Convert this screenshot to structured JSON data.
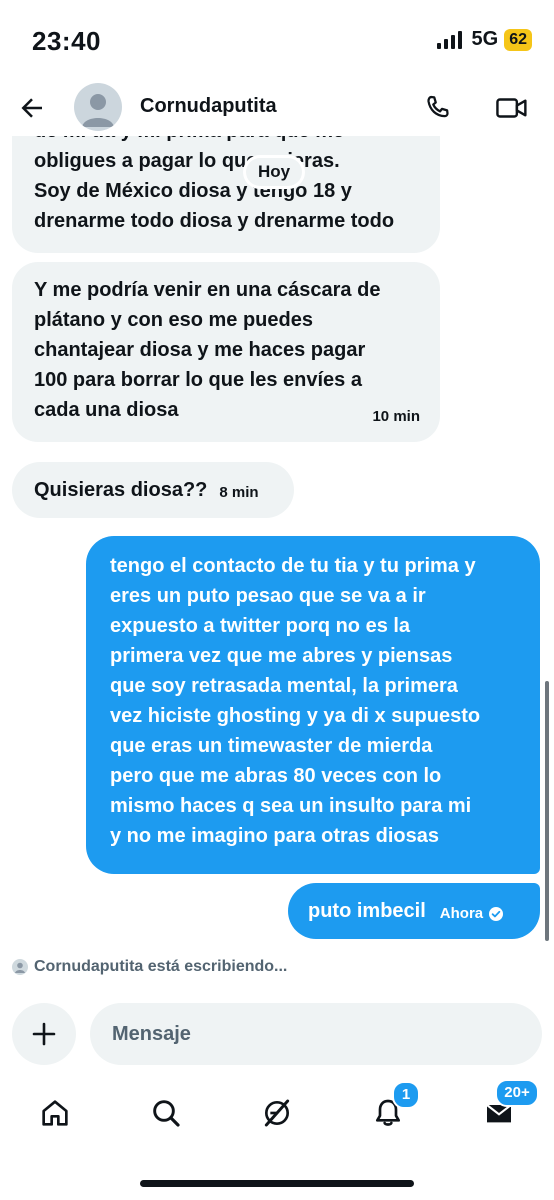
{
  "status_bar": {
    "time": "23:40",
    "network": "5G",
    "battery": "62"
  },
  "header": {
    "contact_name": "Cornudaputita"
  },
  "date_pill": "Hoy",
  "messages": [
    {
      "direction": "in",
      "text": "de mi tia y mi prima para que me\nobligues a pagar lo que quieras.\nSoy de México diosa y tengo 18 y\ndrenarme todo diosa y drenarme todo",
      "time": ""
    },
    {
      "direction": "in",
      "text": "Y me podría venir en una cáscara de\nplátano y con eso me puedes\nchantajear diosa y me haces pagar\n100 para borrar lo que les envíes a\ncada una diosa",
      "time": "10 min"
    },
    {
      "direction": "in",
      "text": "Quisieras diosa??",
      "time": "8 min"
    },
    {
      "direction": "out",
      "text": "tengo el contacto de tu tia y tu prima y\neres un puto pesao que se va a ir\nexpuesto a twitter porq no es la\nprimera vez que me abres y piensas\nque soy retrasada mental, la primera\nvez hiciste ghosting y ya di x supuesto\nque eras un timewaster de mierda\npero que me abras 80 veces con lo\nmismo haces q sea un insulto para mi\ny no me imagino para otras diosas",
      "time": ""
    },
    {
      "direction": "out",
      "text": "puto imbecil",
      "time": "Ahora"
    }
  ],
  "typing_indicator": "Cornudaputita está escribiendo...",
  "composer": {
    "placeholder": "Mensaje"
  },
  "bottom_nav": {
    "notifications_badge": "1",
    "messages_badge": "20+"
  },
  "colors": {
    "accent": "#1d9bf0",
    "bubble_in": "#eff3f4",
    "text": "#0f1419",
    "muted": "#536471",
    "battery": "#f5c518"
  }
}
